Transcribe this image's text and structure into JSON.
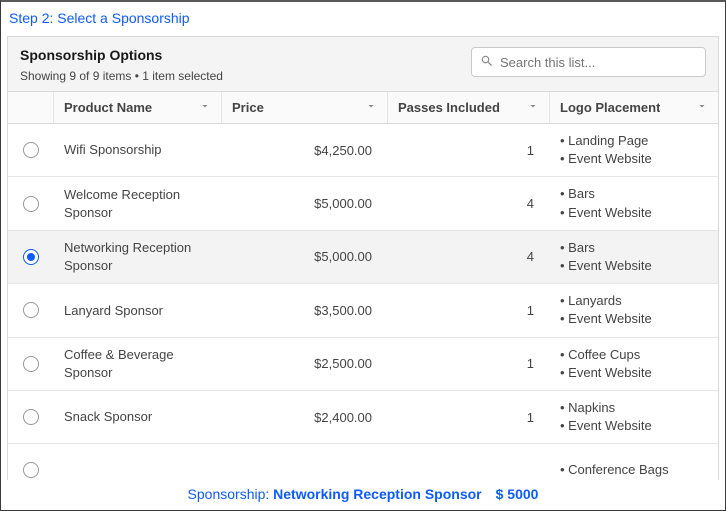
{
  "step_title": "Step 2: Select a Sponsorship",
  "panel": {
    "title": "Sponsorship Options",
    "subtitle": "Showing 9 of 9 items • 1 item selected"
  },
  "search": {
    "placeholder": "Search this list..."
  },
  "columns": {
    "name": "Product Name",
    "price": "Price",
    "passes": "Passes Included",
    "logo": "Logo Placement"
  },
  "rows": [
    {
      "selected": false,
      "name": "Wifi Sponsorship",
      "price": "$4,250.00",
      "passes": "1",
      "logo": [
        "Landing Page",
        "Event Website"
      ]
    },
    {
      "selected": false,
      "name": "Welcome Reception Sponsor",
      "price": "$5,000.00",
      "passes": "4",
      "logo": [
        "Bars",
        "Event Website"
      ]
    },
    {
      "selected": true,
      "name": "Networking Reception Sponsor",
      "price": "$5,000.00",
      "passes": "4",
      "logo": [
        "Bars",
        "Event Website"
      ]
    },
    {
      "selected": false,
      "name": "Lanyard Sponsor",
      "price": "$3,500.00",
      "passes": "1",
      "logo": [
        "Lanyards",
        "Event Website"
      ]
    },
    {
      "selected": false,
      "name": "Coffee & Beverage Sponsor",
      "price": "$2,500.00",
      "passes": "1",
      "logo": [
        "Coffee Cups",
        "Event Website"
      ]
    },
    {
      "selected": false,
      "name": "Snack Sponsor",
      "price": "$2,400.00",
      "passes": "1",
      "logo": [
        "Napkins",
        "Event Website"
      ]
    },
    {
      "selected": false,
      "name": "",
      "price": "",
      "passes": "",
      "logo": [
        "Conference Bags"
      ]
    }
  ],
  "footer": {
    "label": "Sponsorship: ",
    "value": "Networking Reception Sponsor",
    "amount": "$ 5000"
  }
}
